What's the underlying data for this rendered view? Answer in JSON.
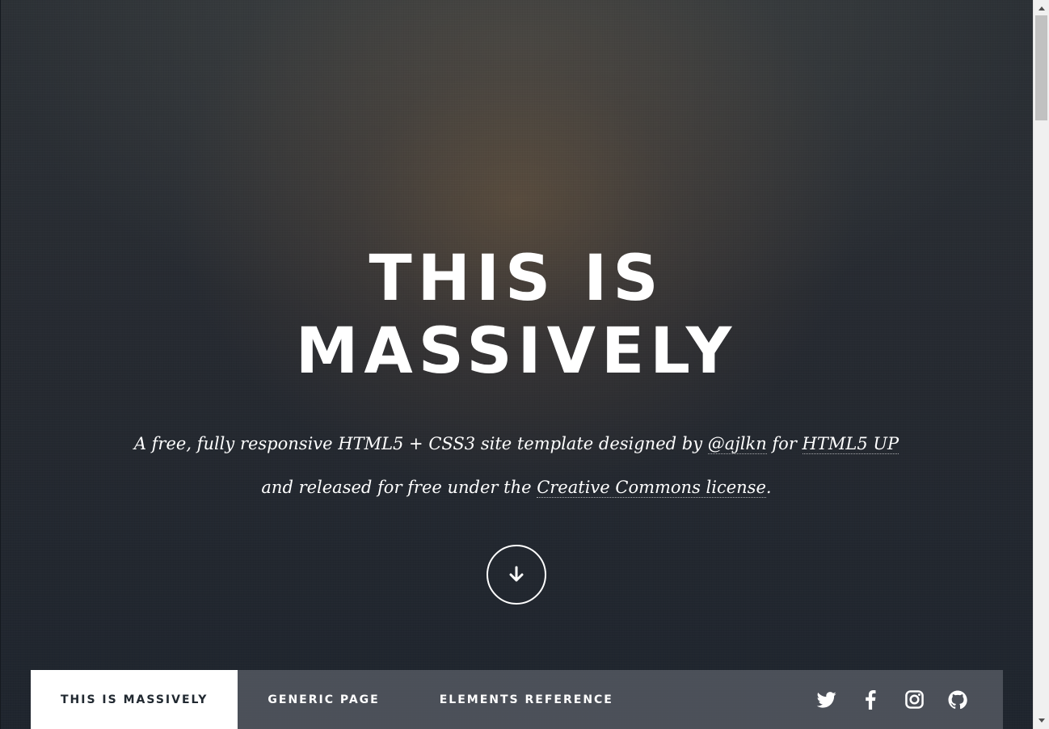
{
  "intro": {
    "title_line1": "This is",
    "title_line2": "Massively",
    "desc_part1": "A free, fully responsive HTML5 + CSS3 site template designed by ",
    "desc_link1": "@ajlkn",
    "desc_part2": " for ",
    "desc_link2": "HTML5 UP",
    "desc_part3": " and released for free under the ",
    "desc_link3": "Creative Commons license",
    "desc_part4": ".",
    "down_icon": "arrow-down-icon"
  },
  "nav": {
    "links": [
      {
        "label": "This is Massively",
        "active": true
      },
      {
        "label": "Generic Page",
        "active": false
      },
      {
        "label": "Elements Reference",
        "active": false
      }
    ],
    "icons": [
      "twitter-icon",
      "facebook-icon",
      "instagram-icon",
      "github-icon"
    ]
  },
  "colors": {
    "text": "#ffffff",
    "active_nav_text": "#212931",
    "nav_bg": "#545860"
  }
}
